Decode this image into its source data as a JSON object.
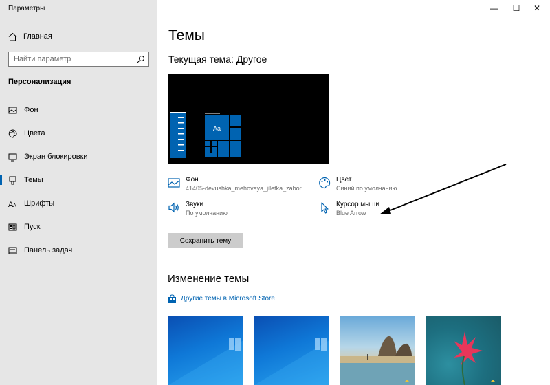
{
  "window": {
    "title": "Параметры",
    "minimize_glyph": "—",
    "maximize_glyph": "☐",
    "close_glyph": "✕"
  },
  "sidebar": {
    "home_label": "Главная",
    "search_placeholder": "Найти параметр",
    "section_title": "Персонализация",
    "items": [
      {
        "label": "Фон",
        "icon": "picture-icon"
      },
      {
        "label": "Цвета",
        "icon": "palette-icon"
      },
      {
        "label": "Экран блокировки",
        "icon": "lock-screen-icon"
      },
      {
        "label": "Темы",
        "icon": "brush-icon",
        "active": true
      },
      {
        "label": "Шрифты",
        "icon": "font-icon"
      },
      {
        "label": "Пуск",
        "icon": "start-icon"
      },
      {
        "label": "Панель задач",
        "icon": "taskbar-icon"
      }
    ]
  },
  "main": {
    "title": "Темы",
    "current_theme": "Текущая тема: Другое",
    "preview_tile_text": "Aa",
    "properties": {
      "background": {
        "title": "Фон",
        "value": "41405-devushka_mehovaya_jiletka_zabor"
      },
      "color": {
        "title": "Цвет",
        "value": "Синий по умолчанию"
      },
      "sounds": {
        "title": "Звуки",
        "value": "По умолчанию"
      },
      "cursor": {
        "title": "Курсор мыши",
        "value": "Blue Arrow"
      }
    },
    "save_button": "Сохранить тему",
    "change_title": "Изменение темы",
    "store_link": "Другие темы в Microsoft Store"
  },
  "colors": {
    "accent": "#0063b1",
    "sidebar_bg": "#e6e6e6",
    "button_bg": "#cccccc"
  }
}
